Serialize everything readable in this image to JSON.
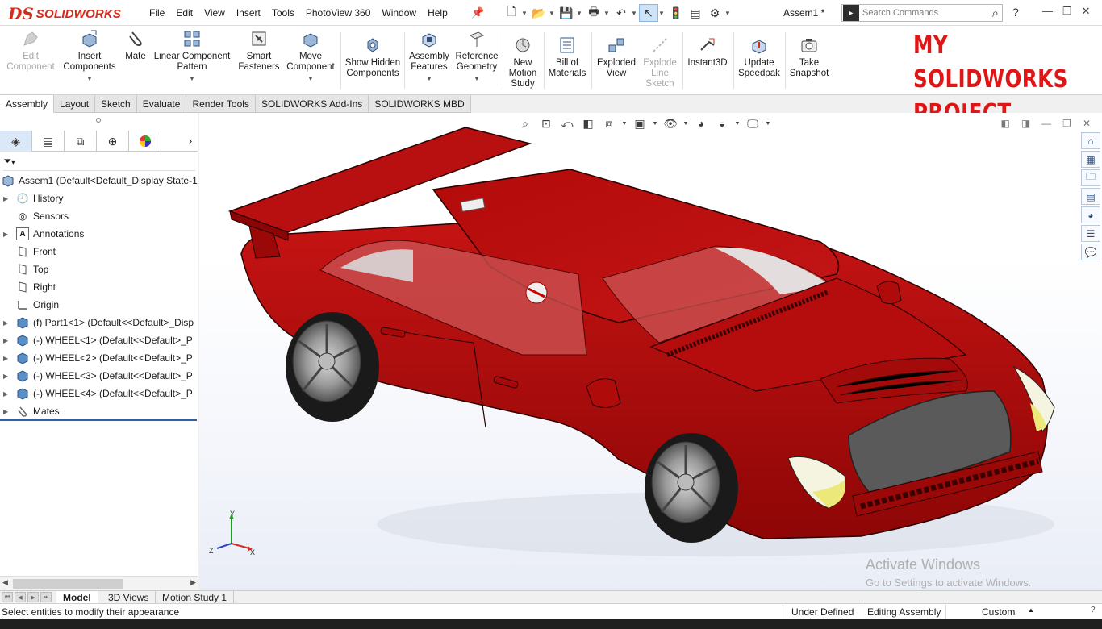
{
  "app": {
    "logo_mark": "DS",
    "logo_text": "SOLIDWORKS",
    "document_title": "Assem1 *"
  },
  "menu": [
    "File",
    "Edit",
    "View",
    "Insert",
    "Tools",
    "PhotoView 360",
    "Window",
    "Help"
  ],
  "search": {
    "placeholder": "Search Commands"
  },
  "ribbon": {
    "buttons": [
      {
        "label": "Edit Component",
        "icon": "edit-component-icon",
        "enabled": false
      },
      {
        "label": "Insert Components",
        "icon": "insert-components-icon",
        "enabled": true
      },
      {
        "label": "Mate",
        "icon": "paperclip-icon",
        "enabled": true
      },
      {
        "label": "Linear Component Pattern",
        "icon": "pattern-icon",
        "enabled": true
      },
      {
        "label": "Smart Fasteners",
        "icon": "fastener-icon",
        "enabled": true
      },
      {
        "label": "Move Component",
        "icon": "move-component-icon",
        "enabled": true
      },
      {
        "label": "Show Hidden Components",
        "icon": "show-hidden-icon",
        "enabled": true
      },
      {
        "label": "Assembly Features",
        "icon": "assembly-features-icon",
        "enabled": true
      },
      {
        "label": "Reference Geometry",
        "icon": "reference-geometry-icon",
        "enabled": true
      },
      {
        "label": "New Motion Study",
        "icon": "motion-study-icon",
        "enabled": true
      },
      {
        "label": "Bill of Materials",
        "icon": "bom-icon",
        "enabled": true
      },
      {
        "label": "Exploded View",
        "icon": "exploded-view-icon",
        "enabled": true
      },
      {
        "label": "Explode Line Sketch",
        "icon": "explode-line-icon",
        "enabled": false
      },
      {
        "label": "Instant3D",
        "icon": "instant3d-icon",
        "enabled": true
      },
      {
        "label": "Update Speedpak",
        "icon": "speedpak-icon",
        "enabled": true
      },
      {
        "label": "Take Snapshot",
        "icon": "camera-icon",
        "enabled": true
      }
    ],
    "overlay_text_line1": "MY SOLIDWORKS",
    "overlay_text_line2": "PROJECT"
  },
  "command_tabs": [
    "Assembly",
    "Layout",
    "Sketch",
    "Evaluate",
    "Render Tools",
    "SOLIDWORKS Add-Ins",
    "SOLIDWORKS MBD"
  ],
  "feature_tree": {
    "root": "Assem1  (Default<Default_Display State-1",
    "items": [
      {
        "label": "History",
        "icon": "history-icon",
        "expandable": true
      },
      {
        "label": "Sensors",
        "icon": "sensor-icon",
        "expandable": false
      },
      {
        "label": "Annotations",
        "icon": "annotation-icon",
        "expandable": true
      },
      {
        "label": "Front",
        "icon": "plane-icon",
        "expandable": false
      },
      {
        "label": "Top",
        "icon": "plane-icon",
        "expandable": false
      },
      {
        "label": "Right",
        "icon": "plane-icon",
        "expandable": false
      },
      {
        "label": "Origin",
        "icon": "origin-icon",
        "expandable": false
      },
      {
        "label": "(f) Part1<1> (Default<<Default>_Disp",
        "icon": "part-icon",
        "expandable": true
      },
      {
        "label": "(-) WHEEL<1> (Default<<Default>_P",
        "icon": "part-icon",
        "expandable": true
      },
      {
        "label": "(-) WHEEL<2> (Default<<Default>_P",
        "icon": "part-icon",
        "expandable": true
      },
      {
        "label": "(-) WHEEL<3> (Default<<Default>_P",
        "icon": "part-icon",
        "expandable": true
      },
      {
        "label": "(-) WHEEL<4> (Default<<Default>_P",
        "icon": "part-icon",
        "expandable": true
      },
      {
        "label": "Mates",
        "icon": "mates-icon",
        "expandable": true
      }
    ]
  },
  "triad": {
    "x": "X",
    "y": "Y",
    "z": "Z"
  },
  "watermark": {
    "line1": "Activate Windows",
    "line2": "Go to Settings to activate Windows."
  },
  "bottom_tabs": [
    "Model",
    "3D Views",
    "Motion Study 1"
  ],
  "status": {
    "message": "Select entities to modify their appearance",
    "definition": "Under Defined",
    "mode": "Editing Assembly",
    "units": "Custom"
  },
  "colors": {
    "car_body": "#c00a0a",
    "accent": "#d52b1e",
    "overlay_text": "#e01616"
  }
}
